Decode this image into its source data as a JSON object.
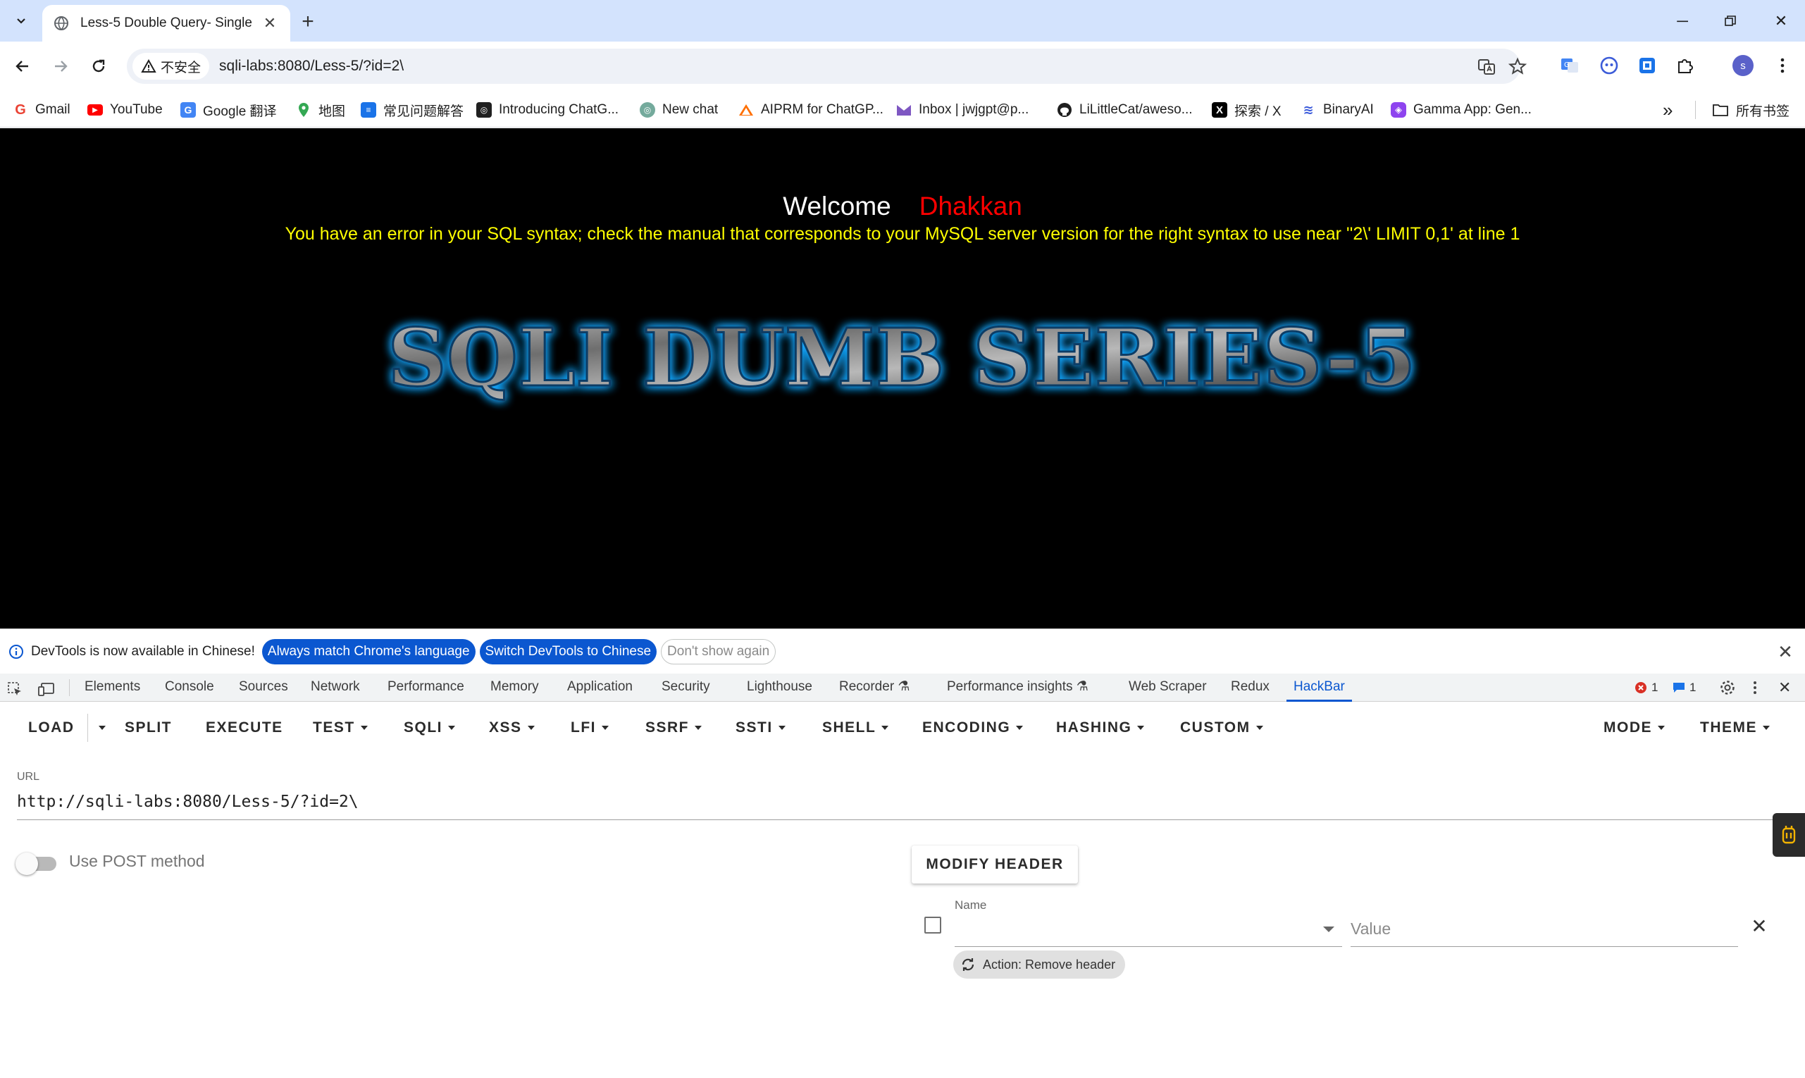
{
  "browser": {
    "tab_title": "Less-5 Double Query- Single",
    "omnibox": {
      "security_label": "不安全",
      "url": "sqli-labs:8080/Less-5/?id=2\\"
    },
    "profile_initial": "s"
  },
  "bookmarks": {
    "items": [
      {
        "label": "Gmail"
      },
      {
        "label": "YouTube"
      },
      {
        "label": "Google 翻译"
      },
      {
        "label": "地图"
      },
      {
        "label": "常见问题解答"
      },
      {
        "label": "Introducing ChatG..."
      },
      {
        "label": "New chat"
      },
      {
        "label": "AIPRM for ChatGP..."
      },
      {
        "label": "Inbox | jwjgpt@p..."
      },
      {
        "label": "LiLittleCat/aweso..."
      },
      {
        "label": "探索 / X"
      },
      {
        "label": "BinaryAI"
      },
      {
        "label": "Gamma App: Gen..."
      }
    ],
    "overflow": "»",
    "all_bookmarks": "所有书签"
  },
  "page": {
    "welcome": "Welcome",
    "user": "Dhakkan",
    "error": "You have an error in your SQL syntax; check the manual that corresponds to your MySQL server version for the right syntax to use near ''2\\' LIMIT 0,1' at line 1",
    "banner": "SQLI DUMB SERIES-5"
  },
  "devtools": {
    "infobar": {
      "text": "DevTools is now available in Chinese!",
      "btn_match": "Always match Chrome's language",
      "btn_switch": "Switch DevTools to Chinese",
      "btn_dismiss": "Don't show again"
    },
    "tabs": [
      "Elements",
      "Console",
      "Sources",
      "Network",
      "Performance",
      "Memory",
      "Application",
      "Security",
      "Lighthouse",
      "Recorder ⚗",
      "Performance insights ⚗",
      "Web Scraper",
      "Redux",
      "HackBar"
    ],
    "active_tab": "HackBar",
    "error_count": "1",
    "message_count": "1"
  },
  "hackbar": {
    "menu": [
      "LOAD",
      "SPLIT",
      "EXECUTE",
      "TEST",
      "SQLI",
      "XSS",
      "LFI",
      "SSRF",
      "SSTI",
      "SHELL",
      "ENCODING",
      "HASHING",
      "CUSTOM",
      "MODE",
      "THEME"
    ],
    "url_label": "URL",
    "url_value": "http://sqli-labs:8080/Less-5/?id=2\\",
    "post_label": "Use POST method",
    "post_enabled": false,
    "modify_header": "MODIFY HEADER",
    "header_name_label": "Name",
    "header_value_placeholder": "Value",
    "header_action": "Action: Remove header"
  },
  "colors": {
    "tabstrip": "#d3e3fd",
    "accent": "#0b57d0",
    "page_bg": "#000000",
    "welcome_user": "#ff0000",
    "error_text": "#ffff00"
  }
}
